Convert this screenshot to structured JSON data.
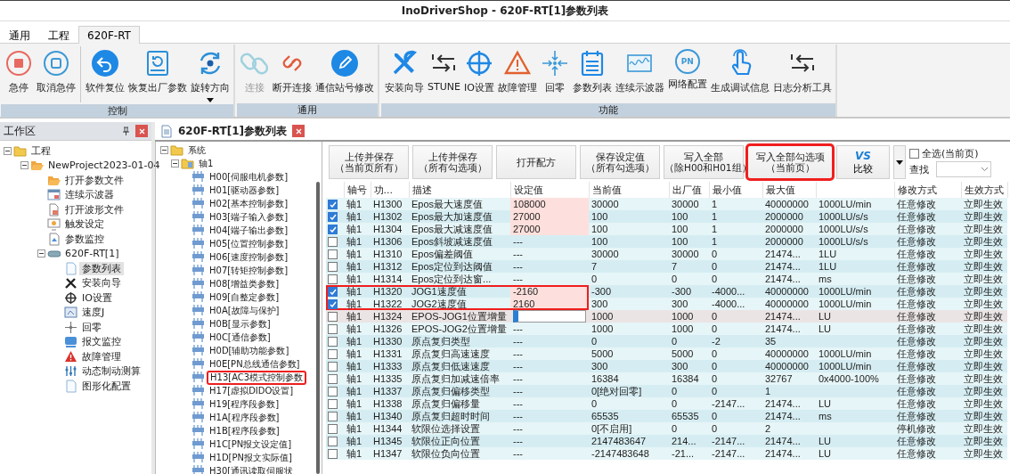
{
  "window": {
    "title": "InoDriverShop - 620F-RT[1]参数列表"
  },
  "ribbon_tabs": [
    {
      "label": "通用",
      "selected": false
    },
    {
      "label": "工程",
      "selected": false
    },
    {
      "label": "620F-RT",
      "selected": true
    }
  ],
  "ribbon_groups": [
    {
      "name": "控制",
      "button_sets": [
        {
          "buttons": [
            {
              "label": "急停",
              "disabled": false,
              "dropdown": false
            },
            {
              "label": "取消急停",
              "disabled": false,
              "dropdown": false
            }
          ]
        },
        {
          "buttons": [
            {
              "label": "软件复位",
              "disabled": false,
              "dropdown": false
            },
            {
              "label": "恢复出厂参数",
              "disabled": false,
              "dropdown": false
            },
            {
              "label": "旋转方向",
              "disabled": false,
              "dropdown": true
            }
          ]
        }
      ]
    },
    {
      "name": "通用",
      "button_sets": [
        {
          "buttons": [
            {
              "label": "连接",
              "disabled": true,
              "dropdown": false
            },
            {
              "label": "断开连接",
              "disabled": false,
              "dropdown": false
            },
            {
              "label": "通信站号修改",
              "disabled": false,
              "dropdown": false
            }
          ]
        }
      ]
    },
    {
      "name": "功能",
      "button_sets": [
        {
          "buttons": [
            {
              "label": "安装向导",
              "disabled": false,
              "dropdown": false
            },
            {
              "label": "STUNE",
              "disabled": false,
              "dropdown": false
            },
            {
              "label": "IO设置",
              "disabled": false,
              "dropdown": false
            },
            {
              "label": "故障管理",
              "disabled": false,
              "dropdown": false
            },
            {
              "label": "回零",
              "disabled": false,
              "dropdown": false
            },
            {
              "label": "参数列表",
              "disabled": false,
              "dropdown": false
            },
            {
              "label": "连续示波器",
              "disabled": false,
              "dropdown": false
            },
            {
              "label": "网络配置",
              "disabled": false,
              "dropdown": false,
              "badge": "PN"
            },
            {
              "label": "生成调试信息",
              "disabled": false,
              "dropdown": false
            },
            {
              "label": "日志分析工具",
              "disabled": false,
              "dropdown": false
            }
          ]
        }
      ]
    }
  ],
  "workspace": {
    "title": "工作区",
    "tree": [
      {
        "label": "工程",
        "kind": "folder",
        "selected": false,
        "expanded": true,
        "children": [
          {
            "label": "NewProject2023-01-04",
            "kind": "folder-open",
            "selected": false,
            "expanded": true,
            "children": [
              {
                "label": "打开参数文件",
                "kind": "folder-open",
                "selected": false
              },
              {
                "label": "连续示波器",
                "kind": "scope",
                "selected": false
              },
              {
                "label": "打开波形文件",
                "kind": "file",
                "selected": false
              },
              {
                "label": "触发设定",
                "kind": "trigger",
                "selected": false
              },
              {
                "label": "参数监控",
                "kind": "monitor",
                "selected": false
              },
              {
                "label": "620F-RT[1]",
                "kind": "device",
                "selected": false,
                "expanded": true,
                "children": [
                  {
                    "label": "参数列表",
                    "kind": "page",
                    "selected": true
                  },
                  {
                    "label": "安装向导",
                    "kind": "tools",
                    "selected": false
                  },
                  {
                    "label": "IO设置",
                    "kind": "crosshair",
                    "selected": false
                  },
                  {
                    "label": "速度J",
                    "kind": "jog",
                    "selected": false
                  },
                  {
                    "label": "回零",
                    "kind": "home",
                    "selected": false
                  },
                  {
                    "label": "报文监控",
                    "kind": "message",
                    "selected": false
                  },
                  {
                    "label": "故障管理",
                    "kind": "fault",
                    "selected": false
                  },
                  {
                    "label": "动态制动测算",
                    "kind": "brake",
                    "selected": false
                  },
                  {
                    "label": "图形化配置",
                    "kind": "page",
                    "selected": false
                  }
                ]
              }
            ]
          }
        ]
      }
    ]
  },
  "document_tab": {
    "title": "620F-RT[1]参数列表"
  },
  "param_tree": [
    {
      "label": "系统",
      "kind": "folder",
      "expanded": true,
      "red_frame": false,
      "children": [
        {
          "label": "轴1",
          "kind": "axis",
          "expanded": true,
          "red_frame": false,
          "children": [
            {
              "label": "H00[伺服电机参数]",
              "kind": "group",
              "red_frame": false
            },
            {
              "label": "H01[驱动器参数]",
              "kind": "group",
              "red_frame": false
            },
            {
              "label": "H02[基本控制参数]",
              "kind": "group",
              "red_frame": false
            },
            {
              "label": "H03[端子输入参数]",
              "kind": "group",
              "red_frame": false
            },
            {
              "label": "H04[端子输出参数]",
              "kind": "group",
              "red_frame": false
            },
            {
              "label": "H05[位置控制参数]",
              "kind": "group",
              "red_frame": false
            },
            {
              "label": "H06[速度控制参数]",
              "kind": "group",
              "red_frame": false
            },
            {
              "label": "H07[转矩控制参数]",
              "kind": "group",
              "red_frame": false
            },
            {
              "label": "H08[增益类参数]",
              "kind": "group",
              "red_frame": false
            },
            {
              "label": "H09[自整定参数]",
              "kind": "group",
              "red_frame": false
            },
            {
              "label": "H0A[故障与保护]",
              "kind": "group",
              "red_frame": false
            },
            {
              "label": "H0B[显示参数]",
              "kind": "group",
              "red_frame": false
            },
            {
              "label": "H0C[通信参数]",
              "kind": "group",
              "red_frame": false
            },
            {
              "label": "H0D[辅助功能参数]",
              "kind": "group",
              "red_frame": false
            },
            {
              "label": "H0E[PN总线通信参数]",
              "kind": "group",
              "red_frame": false
            },
            {
              "label": "H13[AC3模式控制参数",
              "kind": "group",
              "red_frame": true
            },
            {
              "label": "H17[虚拟DIDO设置]",
              "kind": "group",
              "red_frame": false
            },
            {
              "label": "H19[程序段参数]",
              "kind": "group",
              "red_frame": false
            },
            {
              "label": "H1A[程序段参数]",
              "kind": "group",
              "red_frame": false
            },
            {
              "label": "H1B[程序段参数]",
              "kind": "group",
              "red_frame": false
            },
            {
              "label": "H1C[PN报文设定值]",
              "kind": "group",
              "red_frame": false
            },
            {
              "label": "H1D[PN报文实际值]",
              "kind": "group",
              "red_frame": false
            },
            {
              "label": "H30[通讯读取伺服状",
              "kind": "group",
              "red_frame": false
            }
          ]
        }
      ]
    }
  ],
  "toolbar": {
    "buttons": [
      {
        "lines": [
          "上传并保存",
          "（当前页所有）"
        ],
        "red_frame": false
      },
      {
        "lines": [
          "上传并保存",
          "（所有勾选项）"
        ],
        "red_frame": false
      },
      {
        "lines": [
          "打开配方"
        ],
        "red_frame": false
      },
      {
        "lines": [
          "保存设定值",
          "（所有勾选项）"
        ],
        "red_frame": false
      },
      {
        "lines": [
          "写入全部",
          "（除H00和H01组）"
        ],
        "red_frame": false
      },
      {
        "lines": [
          "写入全部勾选项",
          "（当前页）"
        ],
        "red_frame": true
      }
    ],
    "compare": {
      "badge": "VS",
      "label": "比较"
    },
    "select_all": {
      "label": "全选(当前页)",
      "checked": false
    },
    "search": {
      "label": "查找"
    }
  },
  "table": {
    "columns": [
      "轴号",
      "功...",
      "描述",
      "设定值",
      "当前值",
      "出厂值",
      "最小值",
      "最大值",
      null,
      "修改方式",
      "生效方式"
    ],
    "rows": [
      {
        "checked": true,
        "modified": true,
        "editing": false,
        "red_frame": false,
        "cells": [
          "轴1",
          "H1300",
          "Epos最大速度值",
          "108000",
          "30000",
          "30000",
          "1",
          "40000000",
          "1000LU/min",
          "任意修改",
          "立即生效"
        ]
      },
      {
        "checked": true,
        "modified": true,
        "editing": false,
        "red_frame": false,
        "cells": [
          "轴1",
          "H1302",
          "Epos最大加速度值",
          "27000",
          "100",
          "100",
          "1",
          "2000000",
          "1000LU/s/s",
          "任意修改",
          "立即生效"
        ]
      },
      {
        "checked": true,
        "modified": true,
        "editing": false,
        "red_frame": false,
        "cells": [
          "轴1",
          "H1304",
          "Epos最大减速度值",
          "27000",
          "100",
          "100",
          "1",
          "2000000",
          "1000LU/s/s",
          "任意修改",
          "立即生效"
        ]
      },
      {
        "checked": false,
        "modified": false,
        "editing": false,
        "red_frame": false,
        "cells": [
          "轴1",
          "H1306",
          "Epos斜坡减速度值",
          "---",
          "100",
          "100",
          "1",
          "2000000",
          "1000LU/s/s",
          "任意修改",
          "立即生效"
        ]
      },
      {
        "checked": false,
        "modified": false,
        "editing": false,
        "red_frame": false,
        "cells": [
          "轴1",
          "H1310",
          "Epos偏差阈值",
          "---",
          "30000",
          "30000",
          "0",
          "21474...",
          "1LU",
          "任意修改",
          "立即生效"
        ]
      },
      {
        "checked": false,
        "modified": false,
        "editing": false,
        "red_frame": false,
        "cells": [
          "轴1",
          "H1312",
          "Epos定位到达阈值",
          "---",
          "7",
          "7",
          "0",
          "21474...",
          "1LU",
          "任意修改",
          "立即生效"
        ]
      },
      {
        "checked": false,
        "modified": false,
        "editing": false,
        "red_frame": false,
        "cells": [
          "轴1",
          "H1314",
          "Epos定位到达窗...",
          "---",
          "0",
          "0",
          "0",
          "21474...",
          "ms",
          "任意修改",
          "立即生效"
        ]
      },
      {
        "checked": true,
        "modified": true,
        "editing": false,
        "red_frame": true,
        "cells": [
          "轴1",
          "H1320",
          "JOG1速度值",
          "-2160",
          "-300",
          "-300",
          "-4000...",
          "40000000",
          "1000LU/min",
          "任意修改",
          "立即生效"
        ]
      },
      {
        "checked": true,
        "modified": true,
        "editing": false,
        "red_frame": true,
        "cells": [
          "轴1",
          "H1322",
          "JOG2速度值",
          "2160",
          "300",
          "300",
          "-4000...",
          "40000000",
          "1000LU/min",
          "任意修改",
          "立即生效"
        ]
      },
      {
        "checked": false,
        "modified": false,
        "editing": true,
        "red_frame": false,
        "cells": [
          "轴1",
          "H1324",
          "EPOS-JOG1位置增量",
          null,
          "1000",
          "1000",
          "0",
          "21474...",
          "LU",
          "任意修改",
          "立即生效"
        ]
      },
      {
        "checked": false,
        "modified": false,
        "editing": false,
        "red_frame": false,
        "cells": [
          "轴1",
          "H1326",
          "EPOS-JOG2位置增量",
          "---",
          "1000",
          "1000",
          "0",
          "21474...",
          "LU",
          "任意修改",
          "立即生效"
        ]
      },
      {
        "checked": false,
        "modified": false,
        "editing": false,
        "red_frame": false,
        "cells": [
          "轴1",
          "H1330",
          "原点复归类型",
          "---",
          "0",
          "0",
          "-2",
          "35",
          null,
          "任意修改",
          "立即生效"
        ]
      },
      {
        "checked": false,
        "modified": false,
        "editing": false,
        "red_frame": false,
        "cells": [
          "轴1",
          "H1331",
          "原点复归高速速度",
          "---",
          "5000",
          "5000",
          "0",
          "40000000",
          "1000LU/min",
          "任意修改",
          "立即生效"
        ]
      },
      {
        "checked": false,
        "modified": false,
        "editing": false,
        "red_frame": false,
        "cells": [
          "轴1",
          "H1333",
          "原点复归低速速度",
          "---",
          "300",
          "300",
          "0",
          "40000000",
          "1000LU/min",
          "任意修改",
          "立即生效"
        ]
      },
      {
        "checked": false,
        "modified": false,
        "editing": false,
        "red_frame": false,
        "cells": [
          "轴1",
          "H1335",
          "原点复归加减速倍率",
          "---",
          "16384",
          "16384",
          "0",
          "32767",
          "0x4000-100%",
          "任意修改",
          "立即生效"
        ]
      },
      {
        "checked": false,
        "modified": false,
        "editing": false,
        "red_frame": false,
        "cells": [
          "轴1",
          "H1337",
          "原点复归偏移类型",
          "---",
          "0[绝对回零]",
          "0",
          "0",
          "1",
          null,
          "任意修改",
          "立即生效"
        ]
      },
      {
        "checked": false,
        "modified": false,
        "editing": false,
        "red_frame": false,
        "cells": [
          "轴1",
          "H1338",
          "原点复归偏移量",
          "---",
          "0",
          "0",
          "-2147...",
          "21474...",
          "LU",
          "任意修改",
          "立即生效"
        ]
      },
      {
        "checked": false,
        "modified": false,
        "editing": false,
        "red_frame": false,
        "cells": [
          "轴1",
          "H1340",
          "原点复归超时时间",
          "---",
          "65535",
          "65535",
          "0",
          "21474...",
          "ms",
          "任意修改",
          "立即生效"
        ]
      },
      {
        "checked": false,
        "modified": false,
        "editing": false,
        "red_frame": false,
        "cells": [
          "轴1",
          "H1344",
          "软限位选择设置",
          "---",
          "0[不启用]",
          "0",
          "0",
          "2",
          null,
          "停机修改",
          "立即生效"
        ]
      },
      {
        "checked": false,
        "modified": false,
        "editing": false,
        "red_frame": false,
        "cells": [
          "轴1",
          "H1345",
          "软限位正向位置",
          "---",
          "2147483647",
          "214...",
          "-2147...",
          "21474...",
          "LU",
          "任意修改",
          "立即生效"
        ]
      },
      {
        "checked": false,
        "modified": false,
        "editing": false,
        "red_frame": false,
        "cells": [
          "轴1",
          "H1347",
          "软限位负向位置",
          "---",
          "-2147483648",
          "-21...",
          "-2147...",
          "21474...",
          "LU",
          "任意修改",
          "立即生效"
        ]
      }
    ]
  }
}
